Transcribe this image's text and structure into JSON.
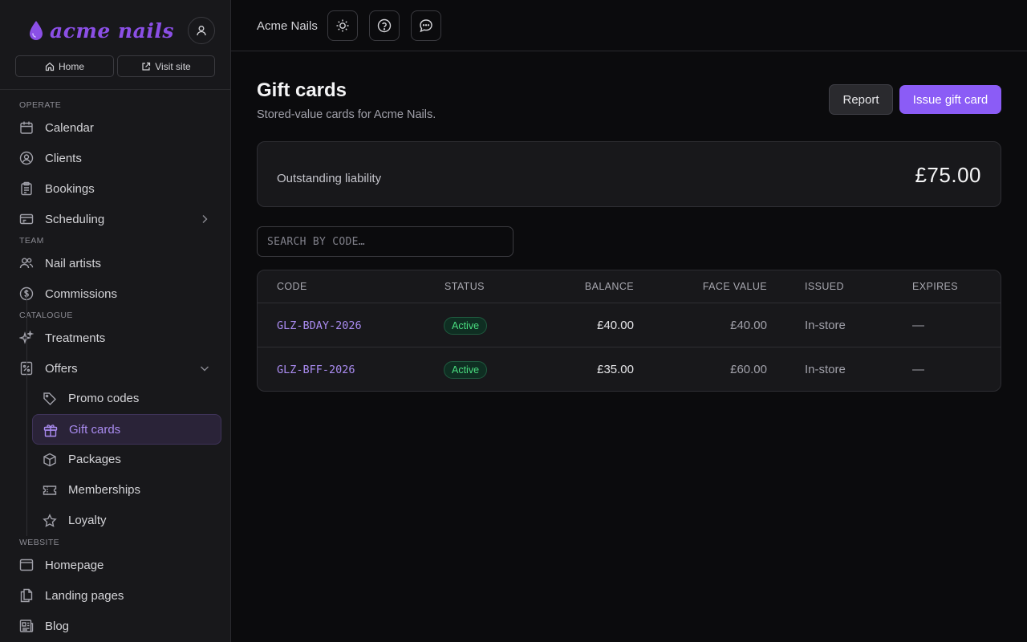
{
  "brand": {
    "name": "acme nails"
  },
  "quick_links": {
    "home": "Home",
    "visit": "Visit site"
  },
  "sidebar": {
    "sections": {
      "operate": "OPERATE",
      "team": "TEAM",
      "catalogue": "CATALOGUE",
      "website": "WEBSITE"
    },
    "items": {
      "calendar": "Calendar",
      "clients": "Clients",
      "bookings": "Bookings",
      "scheduling": "Scheduling",
      "nail_artists": "Nail artists",
      "commissions": "Commissions",
      "treatments": "Treatments",
      "offers": "Offers",
      "promo_codes": "Promo codes",
      "gift_cards": "Gift cards",
      "packages": "Packages",
      "memberships": "Memberships",
      "loyalty": "Loyalty",
      "homepage": "Homepage",
      "landing_pages": "Landing pages",
      "blog": "Blog"
    },
    "active_item": "Gift cards"
  },
  "topbar": {
    "business_name": "Acme Nails"
  },
  "page": {
    "title": "Gift cards",
    "subtitle": "Stored-value cards for Acme Nails.",
    "report_label": "Report",
    "issue_label": "Issue gift card"
  },
  "liability": {
    "label": "Outstanding liability",
    "amount": "£75.00"
  },
  "search": {
    "placeholder": "SEARCH BY CODE…"
  },
  "table": {
    "columns": [
      "CODE",
      "STATUS",
      "BALANCE",
      "FACE VALUE",
      "ISSUED",
      "EXPIRES"
    ],
    "rows": [
      {
        "code": "GLZ-BDAY-2026",
        "status": "Active",
        "balance": "£40.00",
        "face_value": "£40.00",
        "issued": "In-store",
        "expires": "—"
      },
      {
        "code": "GLZ-BFF-2026",
        "status": "Active",
        "balance": "£35.00",
        "face_value": "£60.00",
        "issued": "In-store",
        "expires": "—"
      }
    ]
  },
  "colors": {
    "accent": "#8b5cf6",
    "accent_text": "#a98bf0",
    "status_active": "#4ade80"
  }
}
